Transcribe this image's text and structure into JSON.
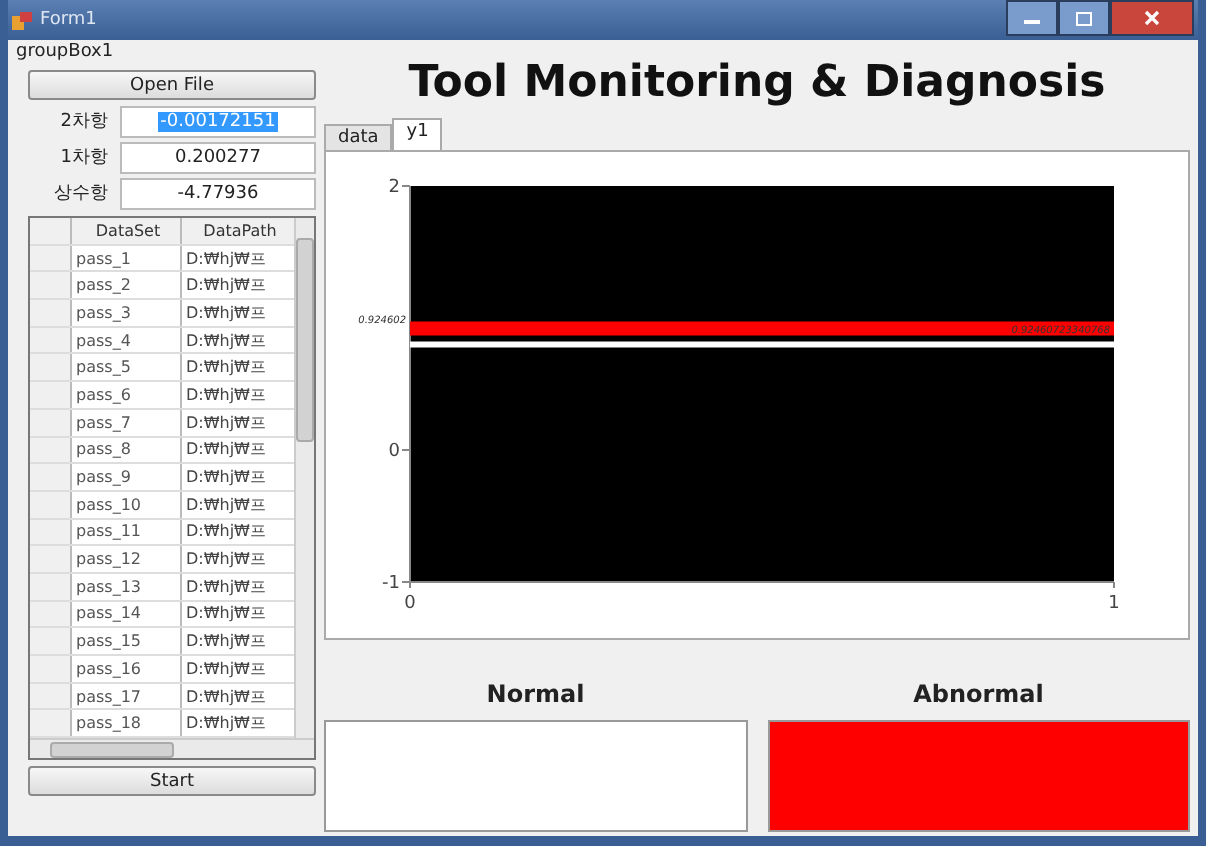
{
  "window": {
    "title": "Form1"
  },
  "group_box": {
    "title": "groupBox1"
  },
  "open_button": "Open File",
  "coefficients": [
    {
      "label": "2차항",
      "value": "-0.00172151",
      "selected": true
    },
    {
      "label": "1차항",
      "value": "0.200277",
      "selected": false
    },
    {
      "label": "상수항",
      "value": "-4.77936",
      "selected": false
    }
  ],
  "table": {
    "columns": [
      "DataSet",
      "DataPath"
    ],
    "rows": [
      [
        "pass_1",
        "D:₩hj₩프"
      ],
      [
        "pass_2",
        "D:₩hj₩프"
      ],
      [
        "pass_3",
        "D:₩hj₩프"
      ],
      [
        "pass_4",
        "D:₩hj₩프"
      ],
      [
        "pass_5",
        "D:₩hj₩프"
      ],
      [
        "pass_6",
        "D:₩hj₩프"
      ],
      [
        "pass_7",
        "D:₩hj₩프"
      ],
      [
        "pass_8",
        "D:₩hj₩프"
      ],
      [
        "pass_9",
        "D:₩hj₩프"
      ],
      [
        "pass_10",
        "D:₩hj₩프"
      ],
      [
        "pass_11",
        "D:₩hj₩프"
      ],
      [
        "pass_12",
        "D:₩hj₩프"
      ],
      [
        "pass_13",
        "D:₩hj₩프"
      ],
      [
        "pass_14",
        "D:₩hj₩프"
      ],
      [
        "pass_15",
        "D:₩hj₩프"
      ],
      [
        "pass_16",
        "D:₩hj₩프"
      ],
      [
        "pass_17",
        "D:₩hj₩프"
      ],
      [
        "pass_18",
        "D:₩hj₩프"
      ]
    ]
  },
  "start_button": "Start",
  "title": "Tool Monitoring & Diagnosis",
  "tabs": [
    {
      "label": "data",
      "selected": false
    },
    {
      "label": "y1",
      "selected": true
    }
  ],
  "chart_data": {
    "type": "line",
    "x": [
      0,
      1
    ],
    "xlim": [
      0,
      1
    ],
    "ylim": [
      -1,
      2
    ],
    "xticks": [
      0,
      1
    ],
    "yticks": [
      -1,
      0,
      2
    ],
    "series": [
      {
        "color": "#ff0000",
        "values": [
          0.92,
          0.92
        ]
      },
      {
        "color": "#ffffff",
        "values": [
          0.8,
          0.8
        ]
      }
    ],
    "annotations": [
      "0.924602",
      "0.92460723340768"
    ]
  },
  "indicators": [
    {
      "label": "Normal",
      "color": "#ffffff"
    },
    {
      "label": "Abnormal",
      "color": "#ff0000"
    }
  ]
}
